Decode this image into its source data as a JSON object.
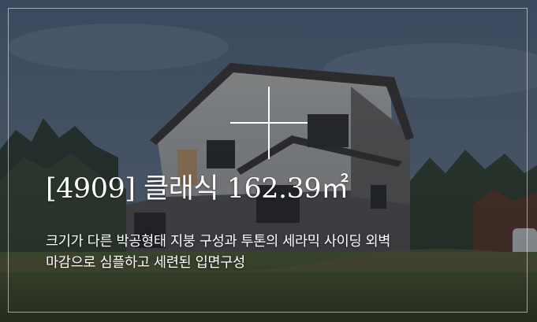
{
  "card": {
    "title": "[4909] 클래식 162.39㎡",
    "description_line1": "크기가 다른 박공형태 지붕 구성과 투톤의 세라믹 사이딩 외벽",
    "description_line2": "마감으로 심플하고 세련된 입면구성"
  },
  "colors": {
    "overlay": "#1c2430",
    "text": "#ffffff",
    "frame": "#ffffff"
  }
}
